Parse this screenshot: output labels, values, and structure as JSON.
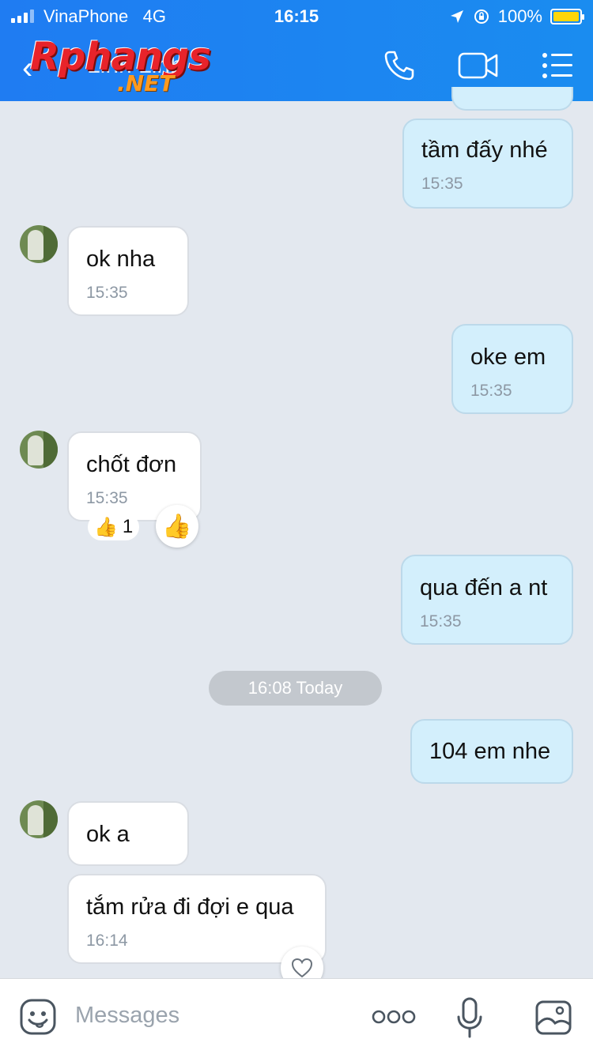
{
  "status_bar": {
    "carrier": "VinaPhone",
    "network": "4G",
    "time": "16:15",
    "battery": "100%",
    "battery_level": 1.0
  },
  "header": {
    "contact_name": "Linh Linh",
    "logo_main": "Rphangs",
    "logo_sub": ".NET"
  },
  "messages": [
    {
      "dir": "out",
      "text": "tầm đấy nhé",
      "time": "15:35"
    },
    {
      "dir": "in",
      "text": "ok nha",
      "time": "15:35"
    },
    {
      "dir": "out",
      "text": "oke em",
      "time": "15:35"
    },
    {
      "dir": "in",
      "text": "chốt đơn",
      "time": "15:35",
      "reaction_count": "1"
    },
    {
      "dir": "out",
      "text": "qua đến a nt",
      "time": "15:35"
    },
    {
      "dir": "out",
      "text": "104 em nhe"
    },
    {
      "dir": "in",
      "text": "ok a"
    },
    {
      "dir": "in",
      "text": "tắm rửa đi đợi e qua",
      "time": "16:14"
    }
  ],
  "date_separator": "16:08 Today",
  "composer": {
    "placeholder": "Messages"
  },
  "colors": {
    "header_blue": "#1f7cf2",
    "outgoing_bubble": "#d3effc",
    "incoming_bubble": "#ffffff",
    "chat_background": "#e3e8ef"
  },
  "icons": [
    "phone-icon",
    "video-call-icon",
    "menu-icon",
    "sticker-icon",
    "more-icon",
    "microphone-icon",
    "image-icon",
    "like-icon",
    "heart-icon"
  ]
}
